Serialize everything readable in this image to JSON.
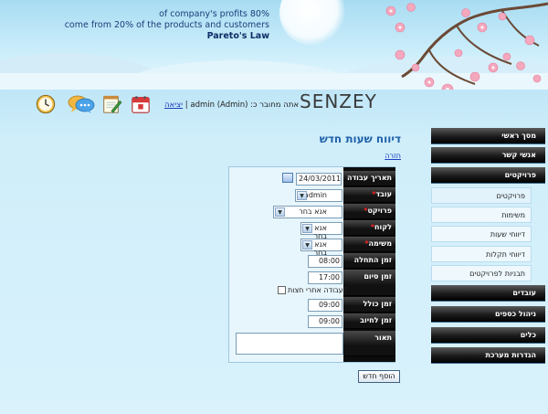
{
  "header": {
    "quote_line1": "of company's profits 80%",
    "quote_line2": "come from 20% of the products and customers",
    "quote_author": "Pareto's Law"
  },
  "toolbar": {
    "logo": "SENZEY",
    "logged_in_text": "אתה מחובר כ: (admin (Admin |",
    "logout_label": "יציאה",
    "icons": [
      "clock-icon",
      "chat-icon",
      "notepad-icon",
      "calendar-icon"
    ]
  },
  "page": {
    "title": "דיווח שעות חדש",
    "back_link": "חזרה"
  },
  "form": {
    "fields": {
      "date": {
        "label": "תאריך עבודה",
        "value": "24/03/2011"
      },
      "worker": {
        "label": "עובד",
        "value": "admin"
      },
      "project": {
        "label": "פרויקט",
        "value": "אנא בחר"
      },
      "customer": {
        "label": "לקוח",
        "value": "אנא בחר"
      },
      "task": {
        "label": "משימה",
        "value": "אנא בחר"
      },
      "start_time": {
        "label": "זמן התחלה",
        "value": "08:00"
      },
      "end_time": {
        "label": "זמן סיום",
        "value": "17:00"
      },
      "after_midnight": {
        "label": "עבודה אחרי חצות?"
      },
      "total_time": {
        "label": "זמן כולל",
        "value": "09:00"
      },
      "billing_time": {
        "label": "זמן לחיוב",
        "value": "09:00"
      },
      "description": {
        "label": "תאור",
        "value": ""
      }
    },
    "submit_label": "הוסף חדש"
  },
  "sidebar": {
    "main_top": [
      {
        "id": "home",
        "label": "מסך ראשי"
      },
      {
        "id": "contacts",
        "label": "אנשי קשר"
      },
      {
        "id": "projects",
        "label": "פרויקטים"
      }
    ],
    "projects_sub": [
      {
        "id": "projects-list",
        "label": "פרויקטים"
      },
      {
        "id": "tasks",
        "label": "משימות"
      },
      {
        "id": "hours-reports",
        "label": "דיווחי שעות"
      },
      {
        "id": "fault-reports",
        "label": "דיווחי תקלות"
      },
      {
        "id": "project-templates",
        "label": "תבניות לפרויקטים"
      }
    ],
    "main_bottom": [
      {
        "id": "workers",
        "label": "עובדים"
      },
      {
        "id": "finance",
        "label": "ניהול כספים"
      },
      {
        "id": "tools",
        "label": "כלים"
      },
      {
        "id": "system-settings",
        "label": "הגדרות מערכת"
      }
    ]
  },
  "colors": {
    "accent": "#1e5fa8",
    "link": "#1a3dbf",
    "nav_dark": "#1b1b1b",
    "required": "#ff2222"
  }
}
